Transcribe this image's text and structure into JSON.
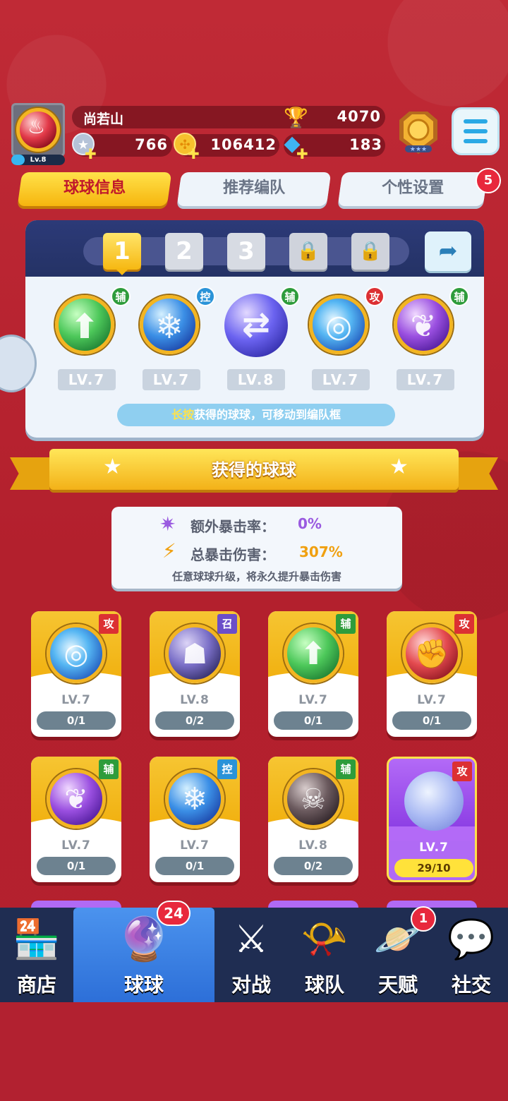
{
  "player": {
    "name": "尚若山",
    "level": "Lv.8",
    "level_progress": 0.25,
    "trophies": "4070"
  },
  "resources": {
    "silver": "766",
    "gold": "106412",
    "diamond": "183"
  },
  "icons": {
    "menu": "menu-icon",
    "medal": "rank-medal-icon",
    "share": "share-icon",
    "lock": "lock-icon"
  },
  "tabs": [
    {
      "label": "球球信息",
      "active": true
    },
    {
      "label": "推荐编队",
      "active": false
    },
    {
      "label": "个性设置",
      "active": false,
      "badge": "5"
    }
  ],
  "team": {
    "slots": [
      "1",
      "2",
      "3"
    ],
    "selected_slot": "1",
    "members": [
      {
        "tag": "辅",
        "tag_color": "green",
        "level": "LV.7",
        "theme": "green-arrow"
      },
      {
        "tag": "控",
        "tag_color": "blue",
        "level": "LV.7",
        "theme": "blue-snowflake"
      },
      {
        "tag": "辅",
        "tag_color": "green",
        "level": "LV.8",
        "theme": "purple-swap"
      },
      {
        "tag": "攻",
        "tag_color": "red",
        "level": "LV.7",
        "theme": "blue-swirl"
      },
      {
        "tag": "辅",
        "tag_color": "green",
        "level": "LV.7",
        "theme": "purple-leaf"
      }
    ],
    "hint_highlight": "长按",
    "hint_text": "获得的球球，可移动到编队框"
  },
  "section_title": "获得的球球",
  "crit": {
    "extra_rate_label": "额外暴击率：",
    "extra_rate_value": "0%",
    "total_damage_label": "总暴击伤害：",
    "total_damage_value": "307%",
    "note": "任意球球升级，将永久提升暴击伤害"
  },
  "collection": [
    {
      "tag": "攻",
      "tag_color": "red",
      "level": "LV.7",
      "progress": "0/1",
      "theme": "blue-swirl"
    },
    {
      "tag": "召",
      "tag_color": "purple",
      "level": "LV.8",
      "progress": "0/2",
      "theme": "purple-ghost"
    },
    {
      "tag": "辅",
      "tag_color": "green",
      "level": "LV.7",
      "progress": "0/1",
      "theme": "green-arrow"
    },
    {
      "tag": "攻",
      "tag_color": "red",
      "level": "LV.7",
      "progress": "0/1",
      "theme": "red-fist"
    },
    {
      "tag": "辅",
      "tag_color": "green",
      "level": "LV.7",
      "progress": "0/1",
      "theme": "purple-leaf"
    },
    {
      "tag": "控",
      "tag_color": "blue",
      "level": "LV.7",
      "progress": "0/1",
      "theme": "blue-snowflake"
    },
    {
      "tag": "辅",
      "tag_color": "green",
      "level": "LV.8",
      "progress": "0/2",
      "theme": "dark-skull"
    },
    {
      "tag": "攻",
      "tag_color": "red",
      "level": "LV.7",
      "progress": "29/10",
      "theme": "moon-bubble",
      "upgradable": true
    }
  ],
  "nav": [
    {
      "label": "商店",
      "icon": "shop-icon"
    },
    {
      "label": "球球",
      "icon": "ball-icon",
      "active": true,
      "badge": "24"
    },
    {
      "label": "对战",
      "icon": "crossed-swords-icon"
    },
    {
      "label": "球队",
      "icon": "whistle-icon"
    },
    {
      "label": "天赋",
      "icon": "planet-icon",
      "badge": "1"
    },
    {
      "label": "社交",
      "icon": "chat-icon"
    }
  ]
}
